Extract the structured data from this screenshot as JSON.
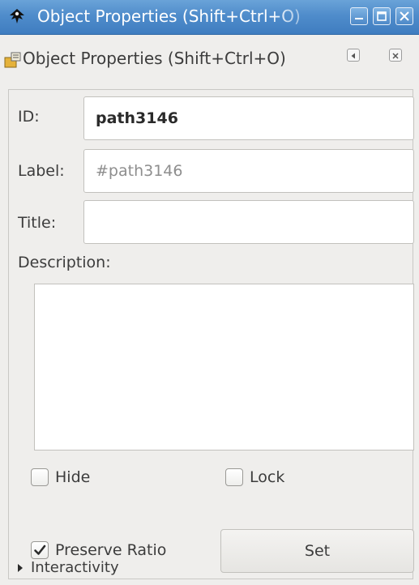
{
  "window": {
    "title": "Object Properties (Shift+Ctrl+O)"
  },
  "dock": {
    "title": "Object Properties (Shift+Ctrl+O)"
  },
  "form": {
    "id_label": "ID:",
    "id_value": "path3146",
    "label_label": "Label:",
    "label_placeholder": "#path3146",
    "title_label": "Title:",
    "title_value": "",
    "description_label": "Description:",
    "description_value": ""
  },
  "options": {
    "hide_label": "Hide",
    "hide_checked": false,
    "lock_label": "Lock",
    "lock_checked": false,
    "preserve_ratio_label": "Preserve Ratio",
    "preserve_ratio_checked": true,
    "set_label": "Set"
  },
  "interactivity": {
    "label": "Interactivity",
    "expanded": false
  },
  "icons": {
    "app": "inkscape-icon",
    "dock": "object-properties-icon",
    "minimize": "minimize-icon",
    "maximize": "maximize-icon",
    "close": "close-icon",
    "iconify": "iconify-icon",
    "dock_close": "dock-close-icon",
    "expander": "triangle-right-icon",
    "check": "checkmark-icon"
  },
  "colors": {
    "titlebar": "#4f8ccb",
    "background": "#efeeec",
    "entry_bg": "#ffffff",
    "text": "#3c3c3c"
  }
}
